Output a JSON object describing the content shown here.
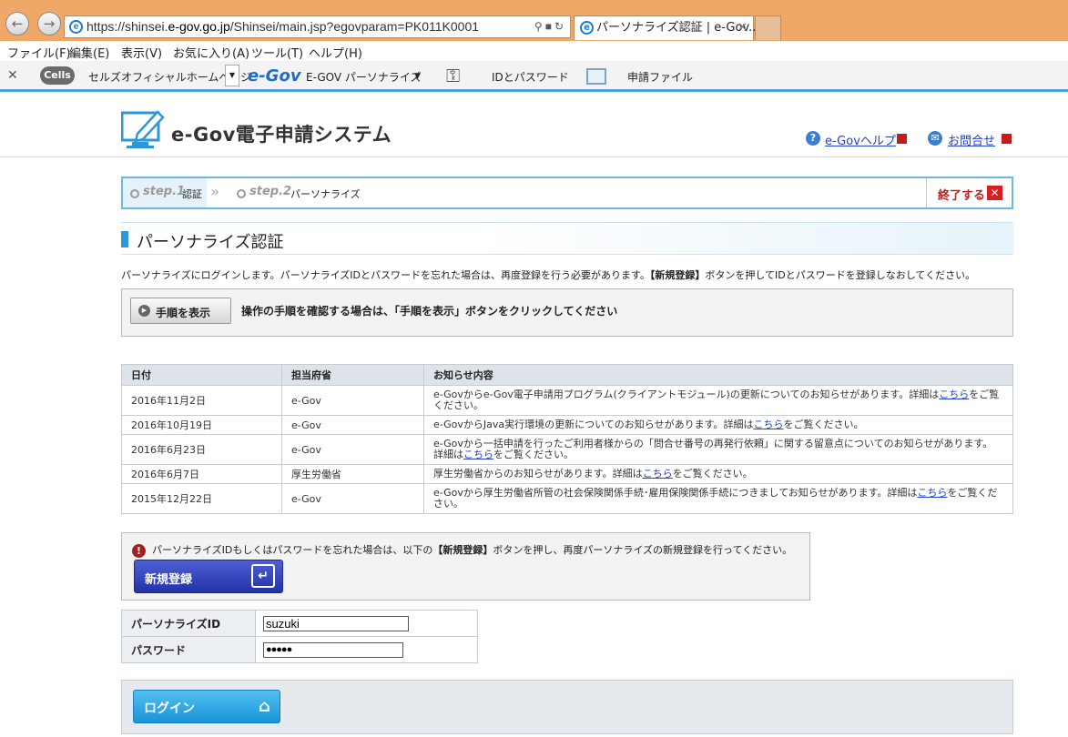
{
  "browser": {
    "url_prefix": "https://shinsei.",
    "url_domain": "e-gov.go.jp",
    "url_rest": "/Shinsei/main.jsp?egovparam=PK011K0001",
    "tab_title": "パーソナライズ認証 | e-Gov...",
    "menu": [
      "ファイル(F)",
      "編集(E)",
      "表示(V)",
      "お気に入り(A)",
      "ツール(T)",
      "ヘルプ(H)"
    ],
    "favorites": {
      "cells_logo": "Cells",
      "cells_label": "セルズオフィシャルホームページ",
      "egov_logo": "e-Gov",
      "egov_label": "E-GOV パーソナライズ",
      "id_pw_label": "IDとパスワード",
      "file_label": "申請ファイル"
    }
  },
  "header": {
    "logo_text": "e-Gov電子申請システム",
    "help_link": "e-Govヘルプ",
    "contact_link": "お問合せ"
  },
  "steps": {
    "step1_num": "step.1",
    "step1_label": "認証",
    "step2_num": "step.2",
    "step2_label": "パーソナライズ",
    "end_label": "終了する"
  },
  "page_title": "パーソナライズ認証",
  "intro": {
    "text_a": "パーソナライズにログインします。パーソナライズIDとパスワードを忘れた場合は、再度登録を行う必要があります。",
    "text_b": "【新規登録】",
    "text_c": "ボタンを押してIDとパスワードを登録しなおしてください。"
  },
  "howto": {
    "button": "手順を表示",
    "message": "操作の手順を確認する場合は、「手順を表示」ボタンをクリックしてください"
  },
  "news": {
    "headers": [
      "日付",
      "担当府省",
      "お知らせ内容"
    ],
    "detail_link": "こちら",
    "rows": [
      {
        "date": "2016年11月2日",
        "ministry": "e-Gov",
        "before": "e-Govからe-Gov電子申請用プログラム(クライアントモジュール)の更新についてのお知らせがあります。詳細は",
        "after": "をご覧ください。"
      },
      {
        "date": "2016年10月19日",
        "ministry": "e-Gov",
        "before": "e-GovからJava実行環境の更新についてのお知らせがあります。詳細は",
        "after": "をご覧ください。"
      },
      {
        "date": "2016年6月23日",
        "ministry": "e-Gov",
        "before": "e-Govから一括申請を行ったご利用者様からの「問合せ番号の再発行依頼」に関する留意点についてのお知らせがあります。詳細は",
        "after": "をご覧ください。"
      },
      {
        "date": "2016年6月7日",
        "ministry": "厚生労働省",
        "before": "厚生労働省からのお知らせがあります。詳細は",
        "after": "をご覧ください。"
      },
      {
        "date": "2015年12月22日",
        "ministry": "e-Gov",
        "before": "e-Govから厚生労働省所管の社会保険関係手続･雇用保険関係手続につきましてお知らせがあります。詳細は",
        "after": "をご覧ください。"
      }
    ]
  },
  "notice": {
    "text_a": "パーソナライズIDもしくはパスワードを忘れた場合は、以下の",
    "text_b": "【新規登録】",
    "text_c": "ボタンを押し、再度パーソナライズの新規登録を行ってください。",
    "register_button": "新規登録"
  },
  "login": {
    "id_label": "パーソナライズID",
    "id_value": "suzuki",
    "pw_label": "パスワード",
    "pw_value": "●●●●●",
    "login_button": "ログイン"
  }
}
